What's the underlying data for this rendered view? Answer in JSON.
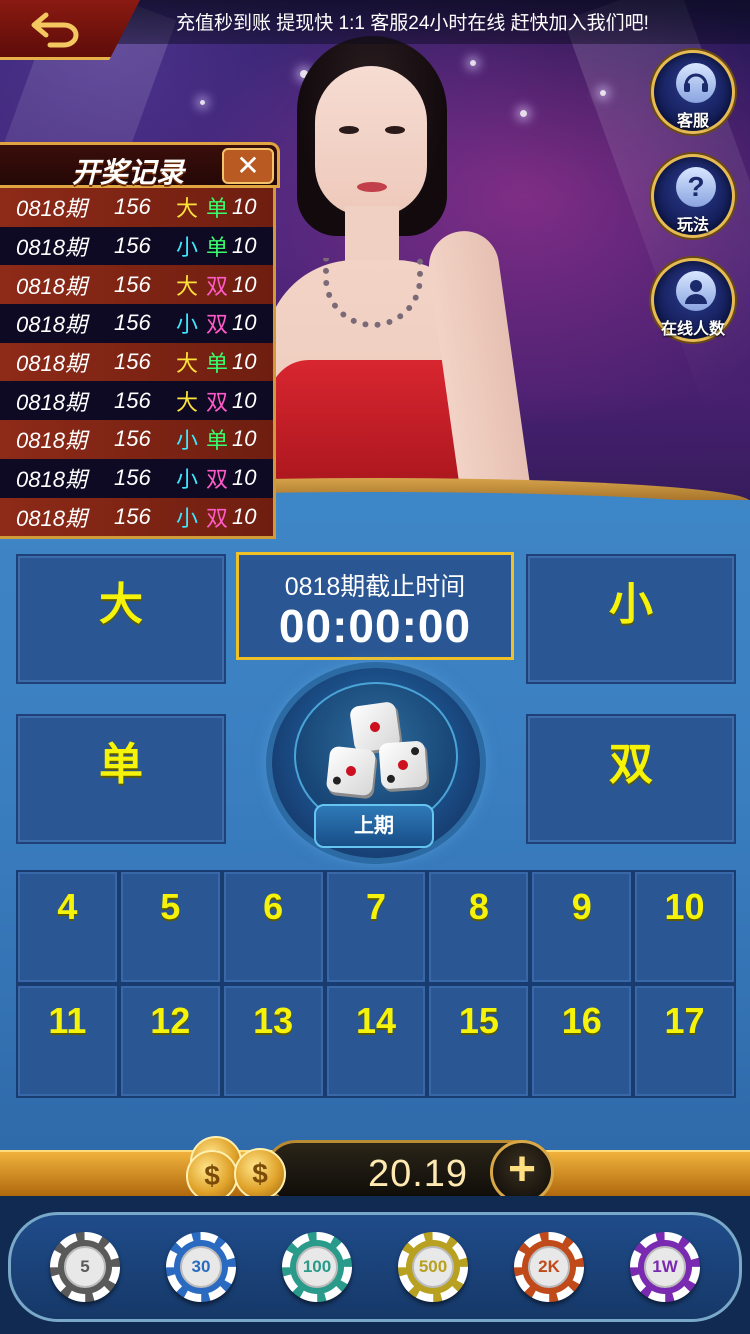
{
  "marquee": "充值秒到账 提现快 1:1 客服24小时在线 赶快加入我们吧!",
  "side_buttons": [
    {
      "label": "客服",
      "icon": "headset-icon"
    },
    {
      "label": "玩法",
      "icon": "question-icon"
    },
    {
      "label": "在线人数",
      "icon": "user-icon"
    }
  ],
  "history": {
    "title": "开奖记录",
    "close": "✕",
    "rows": [
      {
        "period": "0818期",
        "sum": "156",
        "size": "大",
        "parity": "单",
        "value": "10"
      },
      {
        "period": "0818期",
        "sum": "156",
        "size": "小",
        "parity": "单",
        "value": "10"
      },
      {
        "period": "0818期",
        "sum": "156",
        "size": "大",
        "parity": "双",
        "value": "10"
      },
      {
        "period": "0818期",
        "sum": "156",
        "size": "小",
        "parity": "双",
        "value": "10"
      },
      {
        "period": "0818期",
        "sum": "156",
        "size": "大",
        "parity": "单",
        "value": "10"
      },
      {
        "period": "0818期",
        "sum": "156",
        "size": "大",
        "parity": "双",
        "value": "10"
      },
      {
        "period": "0818期",
        "sum": "156",
        "size": "小",
        "parity": "单",
        "value": "10"
      },
      {
        "period": "0818期",
        "sum": "156",
        "size": "小",
        "parity": "双",
        "value": "10"
      },
      {
        "period": "0818期",
        "sum": "156",
        "size": "小",
        "parity": "双",
        "value": "10"
      }
    ]
  },
  "bets": {
    "big": "大",
    "small": "小",
    "odd": "单",
    "even": "双"
  },
  "countdown": {
    "label": "0818期截止时间",
    "time": "00:00:00"
  },
  "dice_button": {
    "label": "上期"
  },
  "numbers": [
    "4",
    "5",
    "6",
    "7",
    "8",
    "9",
    "10",
    "11",
    "12",
    "13",
    "14",
    "15",
    "16",
    "17"
  ],
  "balance": {
    "value": "20.19",
    "plus": "+"
  },
  "chips": [
    {
      "label": "5",
      "color": "#5a5a5a"
    },
    {
      "label": "30",
      "color": "#2a6ac0"
    },
    {
      "label": "100",
      "color": "#2a9a8a"
    },
    {
      "label": "500",
      "color": "#b8a020"
    },
    {
      "label": "2K",
      "color": "#c04a1a"
    },
    {
      "label": "1W",
      "color": "#7a2ab0"
    }
  ],
  "colors": {
    "big_small_big": "#ffe23a",
    "big_small_small": "#3ee8ff",
    "odd": "#38ff6c",
    "even": "#ff5ac8",
    "bet_text": "#f6f30a",
    "table": "#3a7ec0"
  }
}
